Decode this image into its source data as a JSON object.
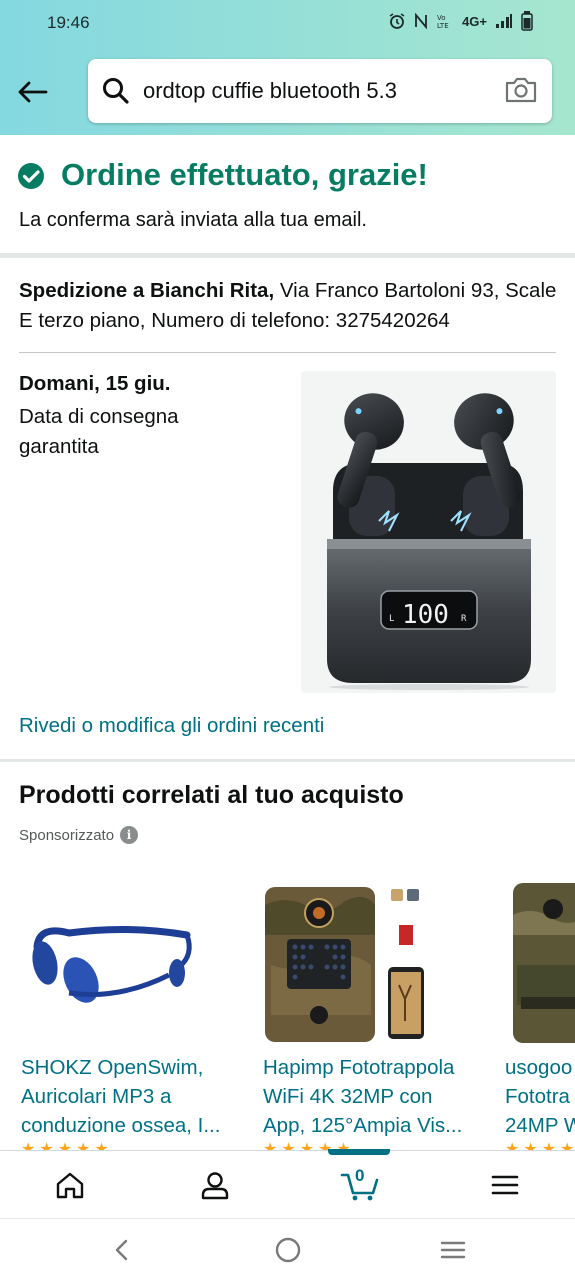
{
  "status_bar": {
    "time": "19:46",
    "network": "4G+"
  },
  "search": {
    "query": "ordtop cuffie bluetooth 5.3"
  },
  "confirmation": {
    "title": "Ordine effettuato, grazie!",
    "subtitle": "La conferma sarà inviata alla tua email."
  },
  "shipping": {
    "label": "Spedizione a Bianchi Rita,",
    "address": " Via Franco Bartoloni 93, Scale E terzo piano, Numero di telefono: 3275420264"
  },
  "delivery": {
    "date": "Domani, 15 giu.",
    "note": "Data di consegna garantita",
    "earbuds_display": "100"
  },
  "orders_link": "Rivedi o modifica gli ordini recenti",
  "related": {
    "title": "Prodotti correlati al tuo acquisto",
    "sponsored": "Sponsorizzato",
    "products": [
      {
        "line1": "SHOKZ OpenSwim,",
        "line2": "Auricolari MP3 a",
        "line3": "conduzione ossea, I..."
      },
      {
        "line1": "Hapimp Fototrappola",
        "line2": "WiFi 4K 32MP con",
        "line3": "App, 125°Ampia Vis..."
      },
      {
        "line1": "usogoo",
        "line2": "Fototra",
        "line3": "24MP W"
      }
    ]
  },
  "bottom_nav": {
    "cart_count": "0"
  },
  "colors": {
    "accent": "#067d62",
    "link": "#007185",
    "header_start": "#84d8e0",
    "header_end": "#a6e6cf"
  }
}
